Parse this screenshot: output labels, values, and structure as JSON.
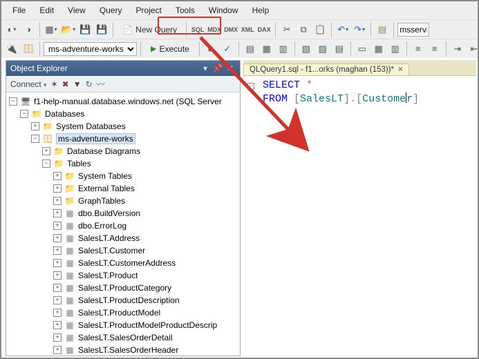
{
  "menu": {
    "items": [
      "File",
      "Edit",
      "View",
      "Query",
      "Project",
      "Tools",
      "Window",
      "Help"
    ]
  },
  "toolbar1": {
    "newquery_label": "New Query",
    "server_text": "msservi"
  },
  "toolbar2": {
    "db_selected": "ms-adventure-works",
    "execute_label": "Execute"
  },
  "object_explorer": {
    "title": "Object Explorer",
    "connect_label": "Connect",
    "root": "f1-help-manual.database.windows.net (SQL Server ",
    "nodes": {
      "databases": "Databases",
      "sysdb": "System Databases",
      "userdb": "ms-adventure-works",
      "diagrams": "Database Diagrams",
      "tables": "Tables",
      "systables": "System Tables",
      "exttables": "External Tables",
      "graphtables": "GraphTables",
      "t0": "dbo.BuildVersion",
      "t1": "dbo.ErrorLog",
      "t2": "SalesLT.Address",
      "t3": "SalesLT.Customer",
      "t4": "SalesLT.CustomerAddress",
      "t5": "SalesLT.Product",
      "t6": "SalesLT.ProductCategory",
      "t7": "SalesLT.ProductDescription",
      "t8": "SalesLT.ProductModel",
      "t9": "SalesLT.ProductModelProductDescrip",
      "t10": "SalesLT.SalesOrderDetail",
      "t11": "SalesLT.SalesOrderHeader"
    }
  },
  "editor": {
    "tab_label": "QLQuery1.sql - f1...orks (maghan (153))*",
    "line1": {
      "select": "SELECT",
      "star": "*"
    },
    "line2": {
      "from": "FROM",
      "br1": "[",
      "id1": "SalesLT",
      "br2": "]",
      "dot": ".",
      "br3": "[",
      "id2a": "Custome",
      "id2b": "r",
      "br4": "]"
    }
  }
}
